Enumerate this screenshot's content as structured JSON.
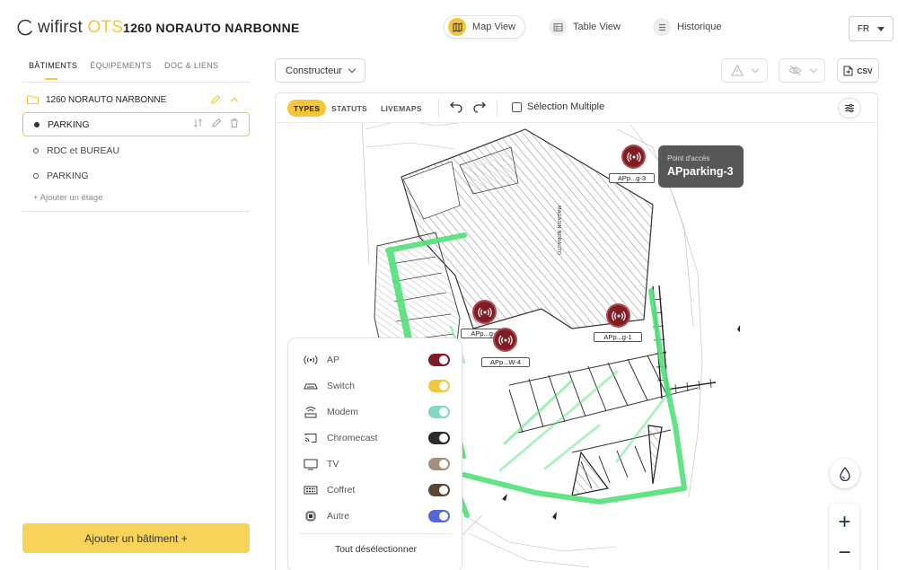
{
  "brand": {
    "name": "wifirst",
    "suffix": "OTS",
    "accent": "#f5c63a"
  },
  "site_title": "1260 NORAUTO NARBONNE",
  "views": [
    {
      "label": "Map View",
      "icon": "map-icon",
      "active": true
    },
    {
      "label": "Table View",
      "icon": "table-icon",
      "active": false
    },
    {
      "label": "Historique",
      "icon": "list-icon",
      "active": false
    }
  ],
  "language": "FR",
  "sidebar": {
    "tabs": [
      {
        "label": "BÂTIMENTS",
        "active": true
      },
      {
        "label": "ÉQUIPEMENTS",
        "active": false
      },
      {
        "label": "DOC & LIENS",
        "active": false
      }
    ],
    "building": "1260 NORAUTO NARBONNE",
    "floors": [
      {
        "label": "PARKING",
        "selected": true
      },
      {
        "label": "RDC et BUREAU",
        "selected": false
      },
      {
        "label": "PARKING",
        "selected": false
      }
    ],
    "add_floor": "+ Ajouter un étage",
    "add_building": "Ajouter un bâtiment +"
  },
  "toolbar": {
    "constructor": "Constructeur",
    "csv": "CSV"
  },
  "map_toolbar": {
    "pills": [
      {
        "label": "TYPES",
        "active": true
      },
      {
        "label": "STATUTS",
        "active": false
      },
      {
        "label": "LIVEMAPS",
        "active": false
      }
    ],
    "multi_select": "Sélection Multiple"
  },
  "access_points": [
    {
      "label": "APp...g-3"
    },
    {
      "label": "APp...g-2"
    },
    {
      "label": "APp...W-4"
    },
    {
      "label": "APp...g-1"
    }
  ],
  "tooltip": {
    "subtitle": "Point d'accès",
    "title": "APparking-3"
  },
  "map_text": {
    "store": "MAGASIN NORAUTO"
  },
  "legend": {
    "items": [
      {
        "label": "AP",
        "icon": "ap-icon",
        "color": "#7e1e24"
      },
      {
        "label": "Switch",
        "icon": "switch-icon",
        "color": "#f5c63a"
      },
      {
        "label": "Modem",
        "icon": "modem-icon",
        "color": "#7fd9c4"
      },
      {
        "label": "Chromecast",
        "icon": "chromecast-icon",
        "color": "#2b2b2b"
      },
      {
        "label": "TV",
        "icon": "tv-icon",
        "color": "#a48f7c"
      },
      {
        "label": "Coffret",
        "icon": "coffret-icon",
        "color": "#5c4530"
      },
      {
        "label": "Autre",
        "icon": "chip-icon",
        "color": "#5668d8"
      }
    ],
    "clear": "Tout désélectionner"
  },
  "zoom": {
    "in": "+",
    "out": "−"
  }
}
